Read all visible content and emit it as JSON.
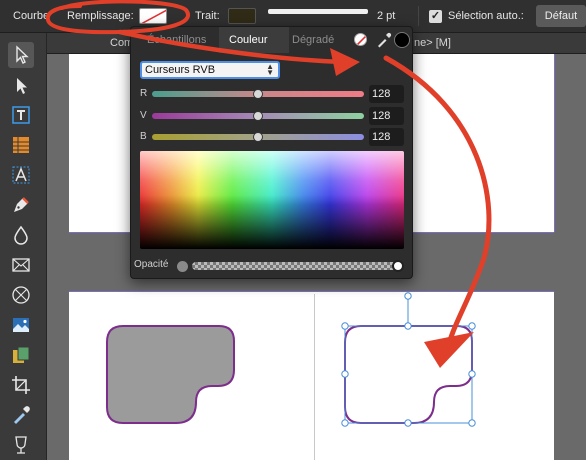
{
  "context_toolbar": {
    "tool_name": "Courbe",
    "fill_label": "Remplissage:",
    "stroke_label": "Trait:",
    "stroke_width": "2 pt",
    "auto_select_label": "Sélection auto.:",
    "auto_select_checked": true,
    "default_button": "Défaut"
  },
  "document_bar": {
    "tab_left": "Com",
    "tab_right": "ne> [M]"
  },
  "color_popover": {
    "tabs": [
      "Échantillons",
      "Couleur",
      "Dégradé"
    ],
    "active_tab": "Couleur",
    "mode_select": "Curseurs RVB",
    "channels": [
      {
        "label": "R",
        "value": "128",
        "level": 0.5
      },
      {
        "label": "V",
        "value": "128",
        "level": 0.5
      },
      {
        "label": "B",
        "value": "128",
        "level": 0.5
      }
    ],
    "opacity_label": "Opacité",
    "opacity_level": 1.0
  },
  "tools": [
    "move-tool",
    "node-tool",
    "frame-text-tool",
    "table-tool",
    "artistic-text-tool",
    "pen-tool",
    "fill-tool",
    "rectangle-tool",
    "ellipse-tool",
    "picture-frame-tool",
    "place-image-tool",
    "crop-tool",
    "color-picker-tool",
    "transparency-tool"
  ],
  "colors": {
    "annotation_red": "#e0402a",
    "shape_fill": "#9b9b9b",
    "shape_stroke": "#7d2d8c",
    "selection_blue": "#4a8fd8"
  }
}
